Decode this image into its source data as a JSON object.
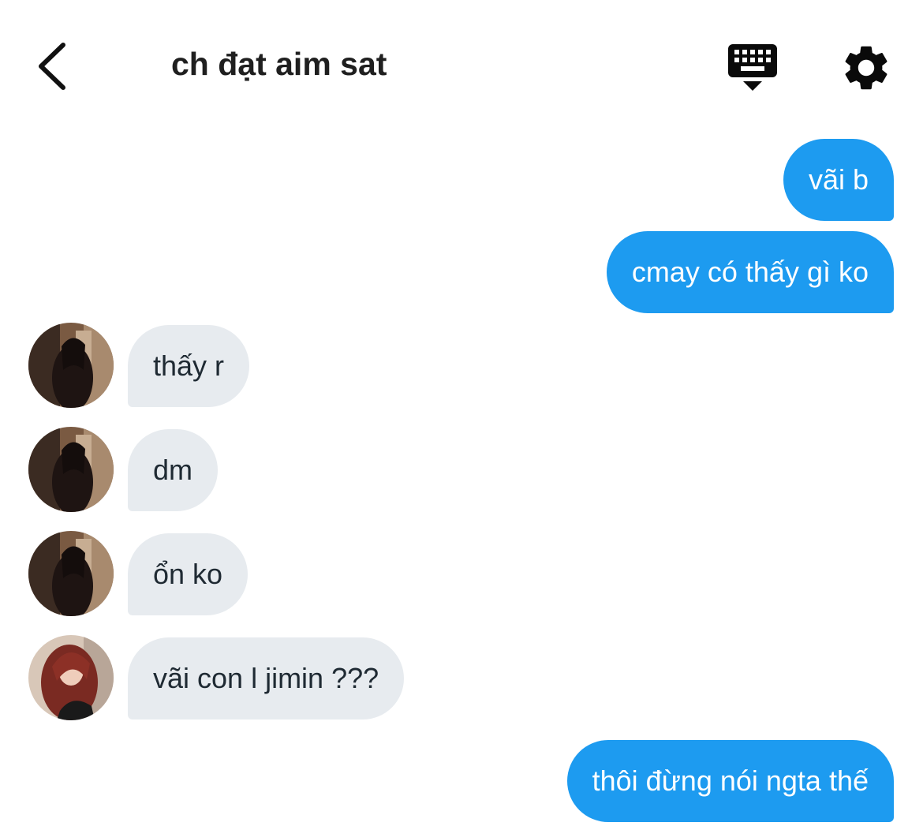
{
  "header": {
    "title": "ch đạt aim sat",
    "back_icon": "chevron-left-icon",
    "keyboard_icon": "keyboard-hide-icon",
    "settings_icon": "gear-icon"
  },
  "colors": {
    "outgoing_bubble": "#1d9bf0",
    "incoming_bubble": "#e7ebef"
  },
  "messages": [
    {
      "direction": "outgoing",
      "text": "vãi b"
    },
    {
      "direction": "outgoing",
      "text": "cmay có thấy gì ko"
    },
    {
      "direction": "incoming",
      "text": "thấy r",
      "sender": "a"
    },
    {
      "direction": "incoming",
      "text": "dm",
      "sender": "a"
    },
    {
      "direction": "incoming",
      "text": "ổn ko",
      "sender": "a"
    },
    {
      "direction": "incoming",
      "text": "vãi con l jimin ???",
      "sender": "b"
    },
    {
      "direction": "outgoing",
      "text": "thôi đừng nói ngta thế"
    }
  ]
}
